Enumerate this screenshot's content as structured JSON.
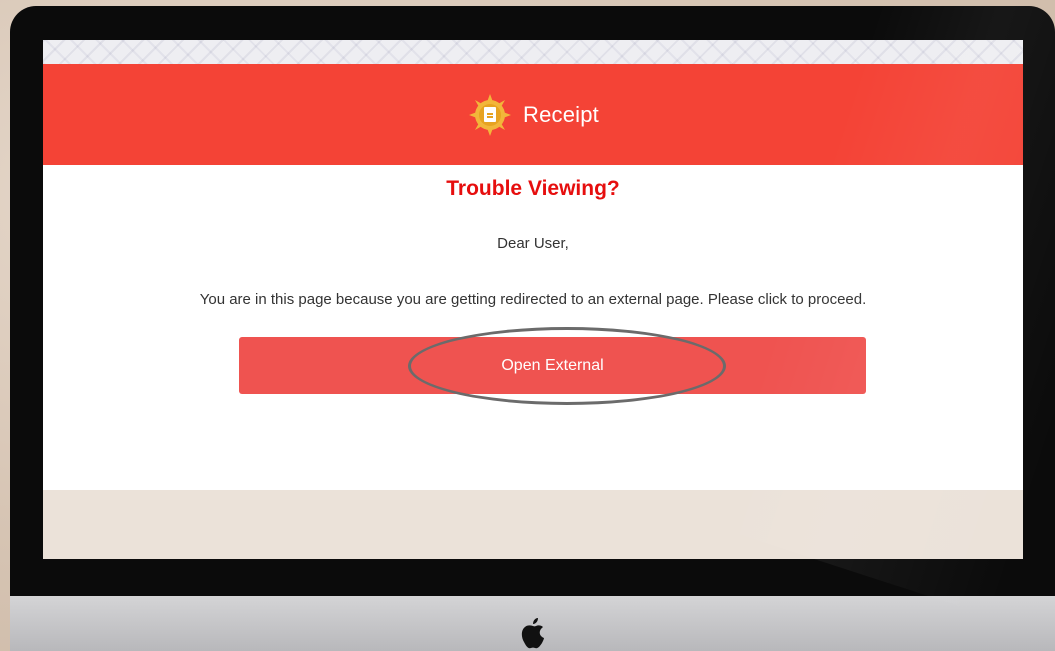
{
  "header": {
    "title": "Receipt",
    "logo_icon": "receipt-document-icon",
    "background_color": "#f44336"
  },
  "content": {
    "heading": "Trouble Viewing?",
    "greeting": "Dear User,",
    "message": "You are in this page because you are getting redirected to an external page. Please click to proceed.",
    "button_label": "Open External",
    "heading_color": "#e60e0e",
    "button_color": "#ef5350"
  },
  "device": {
    "logo_icon": "apple-logo-icon"
  }
}
